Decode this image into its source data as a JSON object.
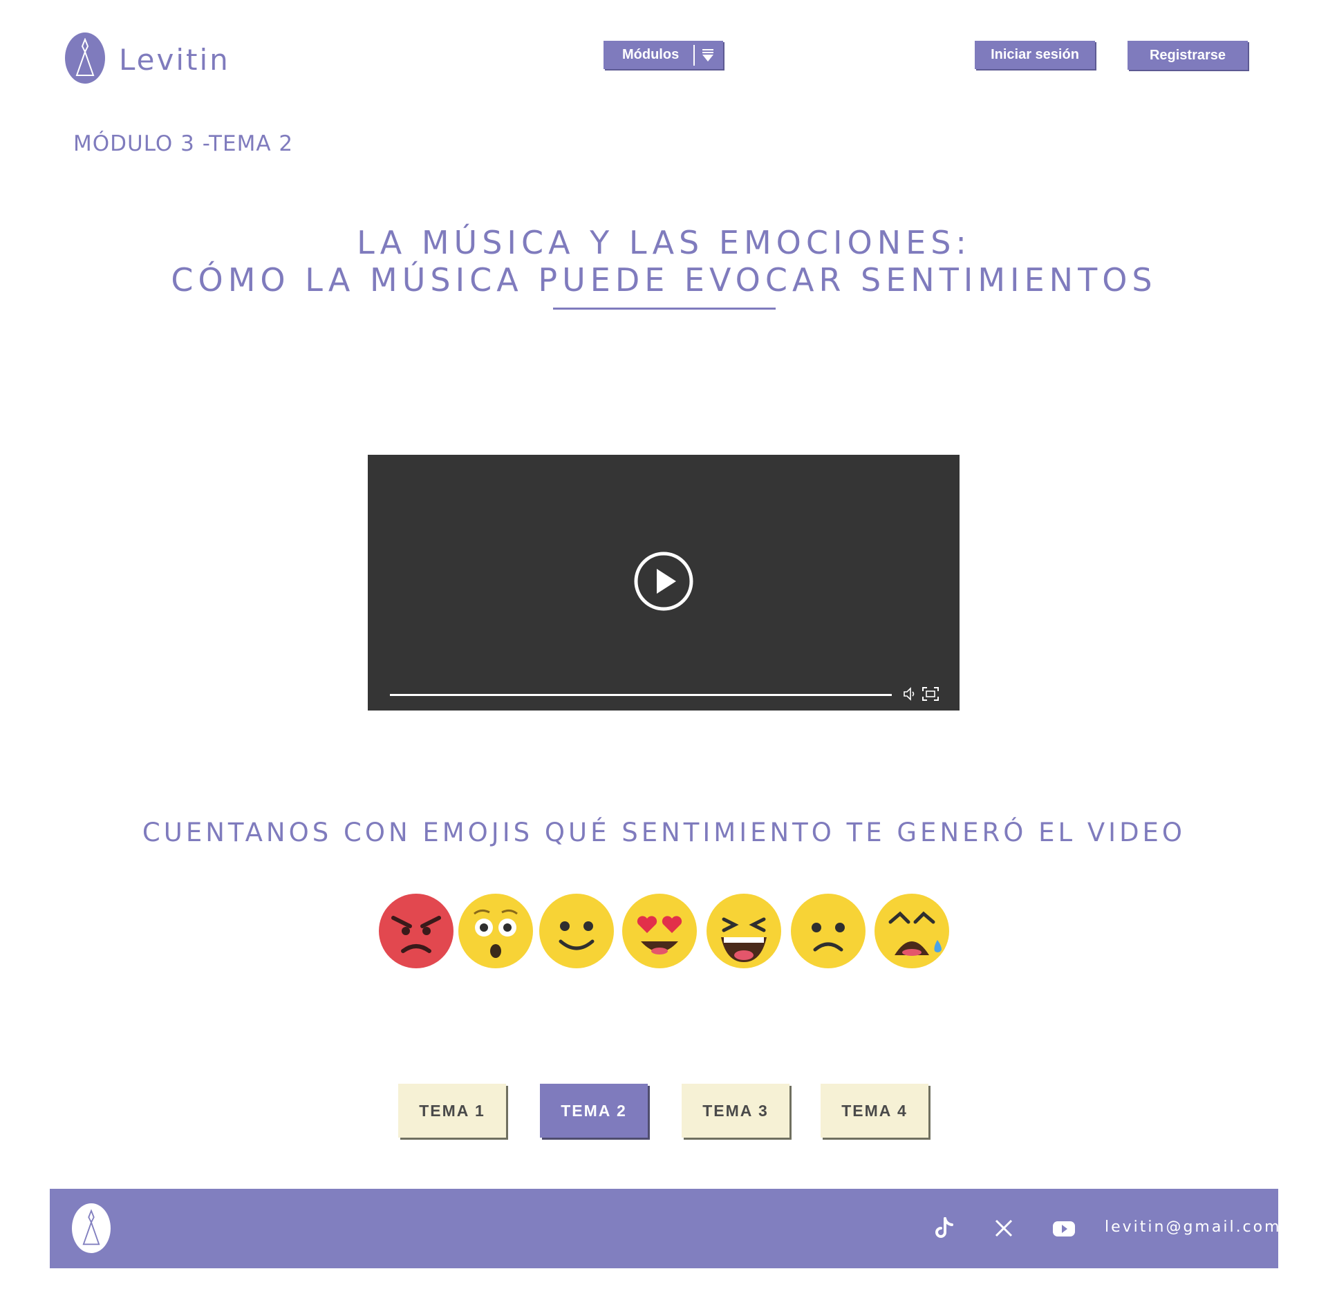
{
  "header": {
    "brand": "Levitin",
    "modules_label": "Módulos",
    "login_label": "Iniciar sesión",
    "register_label": "Registrarse"
  },
  "breadcrumb": "MÓDULO 3 -TEMA 2",
  "title": {
    "line1": "LA MÚSICA Y LAS EMOCIONES:",
    "line2": "CÓMO LA MÚSICA PUEDE EVOCAR SENTIMIENTOS"
  },
  "video": {
    "play_icon": "play-icon",
    "progress": 0,
    "controls": [
      "volume-icon",
      "fullscreen-icon"
    ]
  },
  "prompt": "CUENTANOS CON EMOJIS QUÉ SENTIMIENTO TE GENERÓ EL VIDEO",
  "emojis": [
    "angry",
    "surprised",
    "smiling",
    "heart-eyes",
    "laughing",
    "sad",
    "crying"
  ],
  "topics": [
    {
      "label": "TEMA 1",
      "active": false
    },
    {
      "label": "TEMA 2",
      "active": true
    },
    {
      "label": "TEMA 3",
      "active": false
    },
    {
      "label": "TEMA 4",
      "active": false
    }
  ],
  "footer": {
    "social": [
      "tiktok-icon",
      "x-icon",
      "youtube-icon"
    ],
    "email": "levitin@gmail.com"
  },
  "colors": {
    "accent": "#7f7bbd",
    "video_bg": "#353535",
    "topic_bg": "#f6f1d5"
  }
}
